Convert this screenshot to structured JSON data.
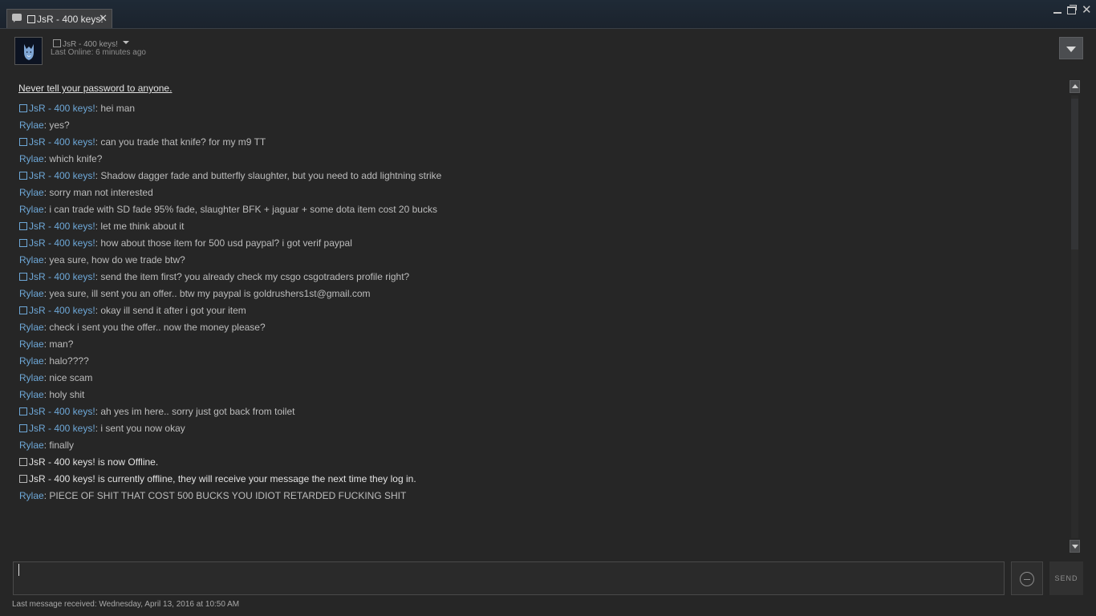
{
  "window": {
    "tab_label": "JsR - 400 keys!",
    "tab_close": "✕",
    "close_glyph": "✕"
  },
  "header": {
    "friend_name": "JsR - 400 keys!",
    "last_online": "Last Online: 6 minutes ago"
  },
  "chat": {
    "warning": "Never tell your password to anyone.",
    "messages": [
      {
        "sender": "JsR - 400 keys!",
        "box": true,
        "text": ": hei man"
      },
      {
        "sender": "Rylae",
        "box": false,
        "text": ": yes?"
      },
      {
        "sender": "JsR - 400 keys!",
        "box": true,
        "text": ": can you trade that knife? for my m9 TT"
      },
      {
        "sender": "Rylae",
        "box": false,
        "text": ": which knife?"
      },
      {
        "sender": "JsR - 400 keys!",
        "box": true,
        "text": ": Shadow dagger fade and butterfly slaughter, but you need to add lightning strike"
      },
      {
        "sender": "Rylae",
        "box": false,
        "text": ": sorry man not interested"
      },
      {
        "sender": "Rylae",
        "box": false,
        "text": ": i can trade with SD fade 95% fade, slaughter BFK + jaguar + some dota item cost 20 bucks"
      },
      {
        "sender": "JsR - 400 keys!",
        "box": true,
        "text": ": let me think about it"
      },
      {
        "sender": "JsR - 400 keys!",
        "box": true,
        "text": ": how about those item for 500 usd paypal? i got verif paypal"
      },
      {
        "sender": "Rylae",
        "box": false,
        "text": ": yea sure, how do we trade btw?"
      },
      {
        "sender": "JsR - 400 keys!",
        "box": true,
        "text": ": send the item first? you already check my csgo csgotraders profile right?"
      },
      {
        "sender": "Rylae",
        "box": false,
        "text": ": yea sure, ill sent you an offer.. btw my paypal is goldrushers1st@gmail.com"
      },
      {
        "sender": "JsR - 400 keys!",
        "box": true,
        "text": ": okay ill send it after i got your item"
      },
      {
        "sender": "Rylae",
        "box": false,
        "text": ": check i sent you the offer.. now the money please?"
      },
      {
        "sender": "Rylae",
        "box": false,
        "text": ": man?"
      },
      {
        "sender": "Rylae",
        "box": false,
        "text": ": halo????"
      },
      {
        "sender": "Rylae",
        "box": false,
        "text": ": nice scam"
      },
      {
        "sender": "Rylae",
        "box": false,
        "text": ": holy shit"
      },
      {
        "sender": "JsR - 400 keys!",
        "box": true,
        "text": ": ah yes im here.. sorry just got back from toilet"
      },
      {
        "sender": "JsR - 400 keys!",
        "box": true,
        "text": ": i sent you now okay"
      },
      {
        "sender": "Rylae",
        "box": false,
        "text": ": finally"
      },
      {
        "sender": "",
        "box": true,
        "system": true,
        "text": "JsR - 400 keys! is now Offline."
      },
      {
        "sender": "",
        "box": true,
        "system": true,
        "text": "JsR - 400 keys! is currently offline, they will receive your message the next time they log in."
      },
      {
        "sender": "Rylae",
        "box": false,
        "text": ": PIECE OF SHIT THAT COST 500 BUCKS YOU IDIOT RETARDED FUCKING SHIT"
      }
    ]
  },
  "composer": {
    "input_value": "",
    "send_label": "SEND"
  },
  "status": {
    "last_received": "Last message received: Wednesday, April 13, 2016 at 10:50 AM"
  },
  "icons": {
    "tab": "chat-bubble-icon",
    "avatar": "wolf-avatar",
    "emoticon": "emoticon-icon"
  },
  "colors": {
    "friend_name": "#6ea8d8",
    "background": "#262626",
    "titlebar": "#1b232d"
  }
}
